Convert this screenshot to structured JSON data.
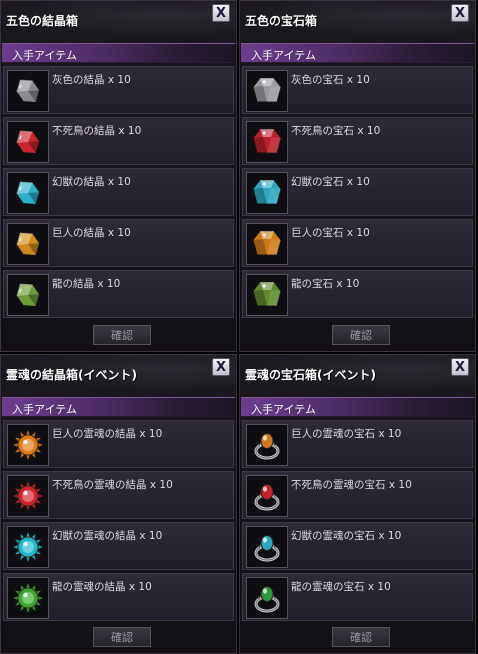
{
  "panels": [
    {
      "title": "五色の結晶箱",
      "close_label": "X",
      "section_label": "入手アイテム",
      "confirm_label": "確認",
      "items": [
        {
          "label": "灰色の結晶 x 10",
          "color": "#8a8a90",
          "icon": "gray-crystal-icon",
          "kind": "crystal"
        },
        {
          "label": "不死鳥の結晶 x 10",
          "color": "#c8262e",
          "icon": "phoenix-crystal-icon",
          "kind": "crystal"
        },
        {
          "label": "幻獣の結晶 x 10",
          "color": "#2bb0c8",
          "icon": "phantom-crystal-icon",
          "kind": "crystal"
        },
        {
          "label": "巨人の結晶 x 10",
          "color": "#d08a1c",
          "icon": "giant-crystal-icon",
          "kind": "crystal"
        },
        {
          "label": "龍の結晶 x 10",
          "color": "#6e9a3a",
          "icon": "dragon-crystal-icon",
          "kind": "crystal"
        }
      ]
    },
    {
      "title": "五色の宝石箱",
      "close_label": "X",
      "section_label": "入手アイテム",
      "confirm_label": "確認",
      "items": [
        {
          "label": "灰色の宝石 x 10",
          "color": "#9a9aa0",
          "icon": "gray-gem-icon",
          "kind": "gem"
        },
        {
          "label": "不死鳥の宝石 x 10",
          "color": "#b8202a",
          "icon": "phoenix-gem-icon",
          "kind": "gem"
        },
        {
          "label": "幻獣の宝石 x 10",
          "color": "#2aa8c0",
          "icon": "phantom-gem-icon",
          "kind": "gem"
        },
        {
          "label": "巨人の宝石 x 10",
          "color": "#d07a18",
          "icon": "giant-gem-icon",
          "kind": "gem"
        },
        {
          "label": "龍の宝石 x 10",
          "color": "#5e8a2a",
          "icon": "dragon-gem-icon",
          "kind": "gem"
        }
      ]
    },
    {
      "title": "霊魂の結晶箱(イベント)",
      "close_label": "X",
      "section_label": "入手アイテム",
      "confirm_label": "確認",
      "items": [
        {
          "label": "巨人の霊魂の結晶 x 10",
          "color": "#e07a18",
          "icon": "giant-soul-crystal-icon",
          "kind": "soul"
        },
        {
          "label": "不死鳥の霊魂の結晶 x 10",
          "color": "#d0202c",
          "icon": "phoenix-soul-crystal-icon",
          "kind": "soul"
        },
        {
          "label": "幻獣の霊魂の結晶 x 10",
          "color": "#20b8d0",
          "icon": "phantom-soul-crystal-icon",
          "kind": "soul"
        },
        {
          "label": "龍の霊魂の結晶 x 10",
          "color": "#3aa830",
          "icon": "dragon-soul-crystal-icon",
          "kind": "soul"
        }
      ]
    },
    {
      "title": "霊魂の宝石箱(イベント)",
      "close_label": "X",
      "section_label": "入手アイテム",
      "confirm_label": "確認",
      "items": [
        {
          "label": "巨人の霊魂の宝石 x 10",
          "color": "#d0781c",
          "icon": "giant-soul-ring-icon",
          "kind": "ring"
        },
        {
          "label": "不死鳥の霊魂の宝石 x 10",
          "color": "#c8202a",
          "icon": "phoenix-soul-ring-icon",
          "kind": "ring"
        },
        {
          "label": "幻獣の霊魂の宝石 x 10",
          "color": "#28a8c0",
          "icon": "phantom-soul-ring-icon",
          "kind": "ring"
        },
        {
          "label": "龍の霊魂の宝石 x 10",
          "color": "#2a9a3a",
          "icon": "dragon-soul-ring-icon",
          "kind": "ring"
        }
      ]
    }
  ]
}
